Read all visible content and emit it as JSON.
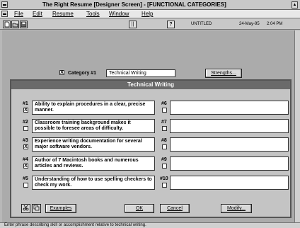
{
  "window": {
    "title": "The Right Resume [Designer Screen] - [FUNCTIONAL CATEGORIES]",
    "maximize_glyph": "▲"
  },
  "menu": [
    "File",
    "Edit",
    "Resume",
    "Tools",
    "Window",
    "Help"
  ],
  "toolbar": {
    "help_glyph": "?",
    "pause_glyph": "||",
    "document": "UNTITLED",
    "date": "24-May-95",
    "time": "2:04 PM"
  },
  "category": {
    "label": "Category #1",
    "checked": true,
    "check_glyph": "X",
    "value": "Technical Writing",
    "strengths_button": "Strengths..."
  },
  "dialog": {
    "title": "Technical Writing",
    "skills": [
      {
        "num": "#1",
        "checked": "X",
        "text": "Ability to explain procedures in a clear, precise manner."
      },
      {
        "num": "#2",
        "checked": "",
        "text": "Classroom training background makes it possible to foresee areas of difficulty."
      },
      {
        "num": "#3",
        "checked": "X",
        "text": "Experience writing documentation for several major software vendors."
      },
      {
        "num": "#4",
        "checked": "X",
        "text": "Author of 7 Macintosh books and numerous articles and reviews."
      },
      {
        "num": "#5",
        "checked": "",
        "text": "Understanding of how to use spelling checkers to check my work."
      },
      {
        "num": "#6",
        "checked": "",
        "text": ""
      },
      {
        "num": "#7",
        "checked": "",
        "text": ""
      },
      {
        "num": "#8",
        "checked": "",
        "text": ""
      },
      {
        "num": "#9",
        "checked": "",
        "text": ""
      },
      {
        "num": "#10",
        "checked": "",
        "text": ""
      }
    ],
    "examples_button": "Examples",
    "ok_button": "OK",
    "cancel_button": "Cancel",
    "modify_button": "Modify..."
  },
  "status": {
    "text": "Enter phrase describing skill or accomplishment relative to technical writing."
  }
}
